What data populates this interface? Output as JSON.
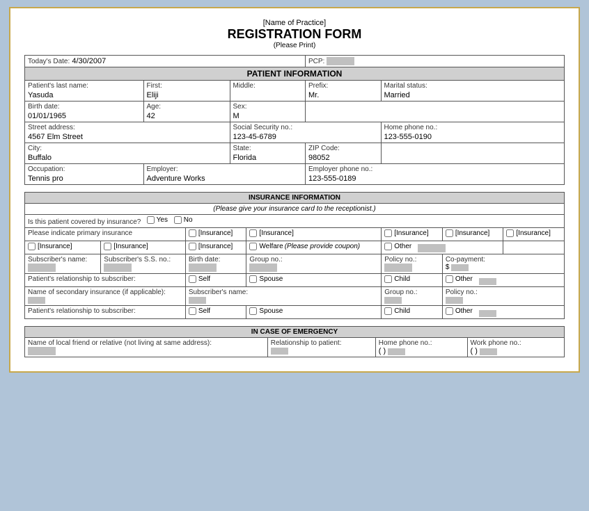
{
  "header": {
    "practice_name": "[Name of Practice]",
    "form_title": "REGISTRATION FORM",
    "form_subtitle": "(Please Print)"
  },
  "patient_info_section": "PATIENT INFORMATION",
  "insurance_info_section": "INSURANCE INFORMATION",
  "insurance_note": "(Please give your insurance card to the receptionist.)",
  "emergency_section": "IN CASE OF EMERGENCY",
  "fields": {
    "today_date_label": "Today's Date:",
    "today_date_value": "4/30/2007",
    "pcp_label": "PCP:",
    "last_name_label": "Patient's last name:",
    "last_name_value": "Yasuda",
    "first_label": "First:",
    "first_value": "Eliji",
    "middle_label": "Middle:",
    "middle_value": "",
    "prefix_label": "Prefix:",
    "prefix_value": "Mr.",
    "marital_label": "Marital status:",
    "marital_value": "Married",
    "birth_label": "Birth date:",
    "birth_value": "01/01/1965",
    "age_label": "Age:",
    "age_value": "42",
    "sex_label": "Sex:",
    "sex_value": "M",
    "street_label": "Street address:",
    "street_value": "4567 Elm Street",
    "ssn_label": "Social Security no.:",
    "ssn_value": "123-45-6789",
    "home_phone_label": "Home phone no.:",
    "home_phone_value": "123-555-0190",
    "city_label": "City:",
    "city_value": "Buffalo",
    "state_label": "State:",
    "state_value": "Florida",
    "zip_label": "ZIP Code:",
    "zip_value": "98052",
    "occupation_label": "Occupation:",
    "occupation_value": "Tennis pro",
    "employer_label": "Employer:",
    "employer_value": "Adventure Works",
    "employer_phone_label": "Employer phone no.:",
    "employer_phone_value": "123-555-0189"
  },
  "insurance": {
    "covered_question": "Is this patient covered by insurance?",
    "yes_label": "Yes",
    "no_label": "No",
    "primary_label": "Please indicate primary insurance",
    "insurance_options": [
      "[Insurance]",
      "[Insurance]",
      "[Insurance]",
      "[Insurance]",
      "[Insurance]"
    ],
    "insurance_options2": [
      "[Insurance]",
      "[Insurance]",
      "[Insurance]"
    ],
    "welfare_label": "Welfare",
    "welfare_note": "(Please provide coupon)",
    "other_label": "Other",
    "subscribers_name_label": "Subscriber's name:",
    "subscribers_ss_label": "Subscriber's S.S. no.:",
    "birth_date_label": "Birth date:",
    "group_no_label": "Group no.:",
    "policy_no_label": "Policy no.:",
    "copay_label": "Co-payment:",
    "dollar_sign": "$",
    "relationship_label": "Patient's relationship to subscriber:",
    "self_label": "Self",
    "spouse_label": "Spouse",
    "child_label": "Child",
    "other2_label": "Other",
    "secondary_label": "Name of secondary insurance (if applicable):",
    "secondary_subscriber_label": "Subscriber's name:",
    "secondary_group_label": "Group no.:",
    "secondary_policy_label": "Policy no.:",
    "relationship2_label": "Patient's relationship to subscriber:",
    "self2_label": "Self",
    "spouse2_label": "Spouse",
    "child2_label": "Child",
    "other3_label": "Other"
  },
  "emergency": {
    "friend_label": "Name of local friend or relative (not living at same address):",
    "relationship_label": "Relationship to patient:",
    "home_phone_label": "Home phone no.:",
    "home_phone_format": "( )",
    "work_phone_label": "Work phone no.:",
    "work_phone_format": "( )"
  }
}
